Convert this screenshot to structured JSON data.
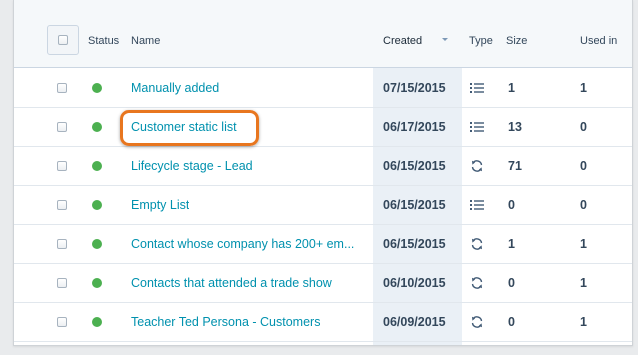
{
  "table": {
    "columns": {
      "status": "Status",
      "name": "Name",
      "created": "Created",
      "type": "Type",
      "size": "Size",
      "used_in": "Used in"
    },
    "sorted_column": "Created",
    "rows": [
      {
        "name": "Manually added",
        "created": "07/15/2015",
        "type_icon": "static-list-icon",
        "size": "1",
        "used_in": "1"
      },
      {
        "name": "Customer static list",
        "created": "06/17/2015",
        "type_icon": "static-list-icon",
        "size": "13",
        "used_in": "0"
      },
      {
        "name": "Lifecycle stage - Lead",
        "created": "06/15/2015",
        "type_icon": "active-list-icon",
        "size": "71",
        "used_in": "0"
      },
      {
        "name": "Empty List",
        "created": "06/15/2015",
        "type_icon": "static-list-icon",
        "size": "0",
        "used_in": "0"
      },
      {
        "name": "Contact whose company has 200+ em...",
        "created": "06/15/2015",
        "type_icon": "active-list-icon",
        "size": "1",
        "used_in": "1"
      },
      {
        "name": "Contacts that attended a trade show",
        "created": "06/10/2015",
        "type_icon": "active-list-icon",
        "size": "0",
        "used_in": "1"
      },
      {
        "name": "Teacher Ted Persona - Customers",
        "created": "06/09/2015",
        "type_icon": "active-list-icon",
        "size": "0",
        "used_in": "1"
      }
    ],
    "highlighted_row_name": "Customer static list"
  },
  "colors": {
    "status_active": "#4cb050",
    "link": "#0091ae",
    "highlight": "#e8761f",
    "sorted_column_bg": "#eaf0f6"
  }
}
